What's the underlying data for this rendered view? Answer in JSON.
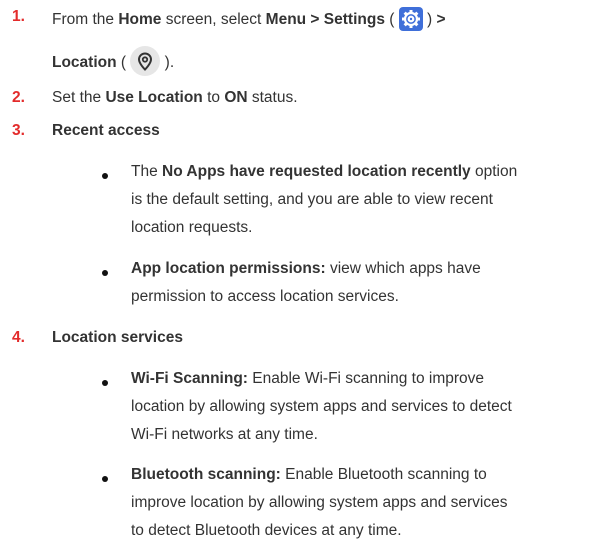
{
  "steps": [
    {
      "number": "1.",
      "line1_a": "From the ",
      "line1_b": "Home",
      "line1_c": " screen, select ",
      "line1_d": "Menu > Settings",
      "line1_e": " ( ",
      "line1_f": " ) ",
      "line1_g": ">",
      "line2_a": "Location",
      "line2_b": " ( ",
      "line2_c": " ).",
      "settings_icon": "gear-icon",
      "location_icon": "location-pin-icon"
    },
    {
      "number": "2.",
      "a": "Set the ",
      "b": "Use Location",
      "c": " to ",
      "d": "ON",
      "e": " status."
    },
    {
      "number": "3.",
      "title": "Recent access",
      "bullets": [
        {
          "l1_a": "The ",
          "l1_b": "No Apps have requested location recently",
          "l1_c": " option",
          "l2": "is the default setting, and you are able to view recent",
          "l3": "location requests."
        },
        {
          "l1_b": "App location permissions:",
          "l1_c": " view which apps have",
          "l2": "permission to access location services."
        }
      ]
    },
    {
      "number": "4.",
      "title": "Location services",
      "bullets": [
        {
          "l1_b": "Wi-Fi Scanning:",
          "l1_c": " Enable Wi-Fi scanning to improve",
          "l2": "location by allowing system apps and services to detect",
          "l3": "Wi-Fi networks at any time."
        },
        {
          "l1_b": "Bluetooth scanning:",
          "l1_c": " Enable Bluetooth scanning to",
          "l2": "improve location by allowing system apps and services",
          "l3": "to detect Bluetooth devices at any time."
        }
      ]
    }
  ],
  "colors": {
    "step_number": "#e32b2b",
    "text": "#333333",
    "settings_icon_bg": "#3f6fd9",
    "location_icon_bg": "#e6e6e6"
  }
}
